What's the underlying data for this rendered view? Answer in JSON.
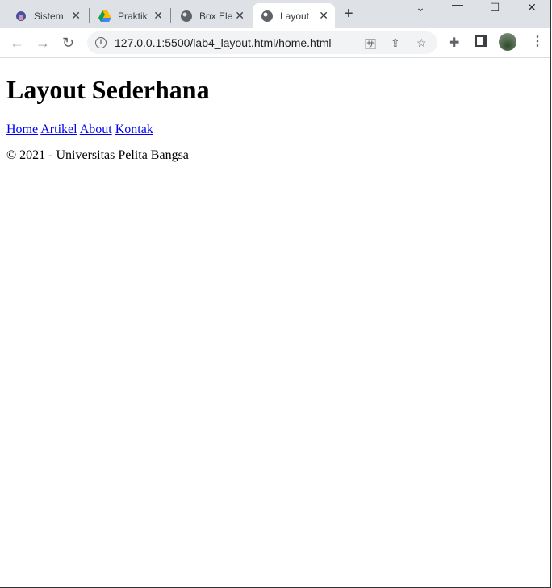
{
  "browser": {
    "tabs": [
      {
        "label": "Sistem",
        "icon": "university-logo-icon",
        "active": false
      },
      {
        "label": "Praktik",
        "icon": "google-drive-icon",
        "active": false
      },
      {
        "label": "Box Ele",
        "icon": "globe-icon",
        "active": false
      },
      {
        "label": "Layout",
        "icon": "globe-icon",
        "active": true
      }
    ],
    "url": "127.0.0.1:5500/lab4_layout.html/home.html"
  },
  "page": {
    "title": "Layout Sederhana",
    "nav": [
      "Home",
      "Artikel",
      "About",
      "Kontak"
    ],
    "footer": "© 2021 - Universitas Pelita Bangsa"
  }
}
